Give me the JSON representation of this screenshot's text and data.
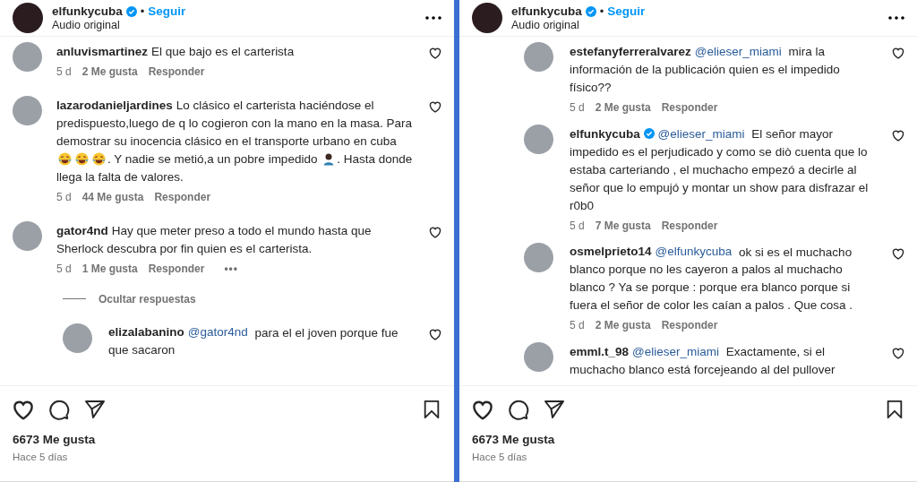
{
  "panels": [
    {
      "header": {
        "username": "elfunkycuba",
        "verified": true,
        "separator": "•",
        "follow": "Seguir",
        "subtitle": "Audio original"
      },
      "comments": [
        {
          "kind": "comment",
          "username": "anluvismartinez",
          "verified": false,
          "body": [
            {
              "kind": "text",
              "text": "El que bajo es el carterista"
            }
          ],
          "age": "5 d",
          "likes": "2 Me gusta",
          "reply": "Responder"
        },
        {
          "kind": "comment",
          "username": "lazarodanieljardines",
          "verified": false,
          "body": [
            {
              "kind": "text",
              "text": "Lo clásico el carterista haciéndose el predispuesto,luego de q lo cogieron con la mano en la masa. Para demostrar su inocencia clásico en el transporte urbano en cuba"
            },
            {
              "kind": "laugh-emoji"
            },
            {
              "kind": "laugh-emoji"
            },
            {
              "kind": "laugh-emoji"
            },
            {
              "kind": "text",
              "text": ". Y nadie se metió,a un pobre impedido"
            },
            {
              "kind": "person-emoji"
            },
            {
              "kind": "text",
              "text": ". Hasta donde llega la falta de valores."
            }
          ],
          "age": "5 d",
          "likes": "44 Me gusta",
          "reply": "Responder"
        },
        {
          "kind": "comment",
          "username": "gator4nd",
          "verified": false,
          "body": [
            {
              "kind": "text",
              "text": "Hay que meter preso a todo el mundo hasta que Sherlock descubra por fin quien es el carterista."
            }
          ],
          "age": "5 d",
          "likes": "1 Me gusta",
          "reply": "Responder",
          "more": "•••"
        },
        {
          "kind": "toggle",
          "text": "Ocultar respuestas"
        },
        {
          "kind": "reply",
          "username": "elizalabanino",
          "verified": false,
          "body": [
            {
              "kind": "mention",
              "text": "@gator4nd"
            },
            {
              "kind": "text",
              "text": "para el el joven porque fue que sacaron"
            }
          ]
        }
      ],
      "likes": "6673 Me gusta",
      "date": "Hace 5 días"
    },
    {
      "header": {
        "username": "elfunkycuba",
        "verified": true,
        "separator": "•",
        "follow": "Seguir",
        "subtitle": "Audio original"
      },
      "comments": [
        {
          "kind": "reply",
          "username": "estefanyferreralvarez",
          "verified": false,
          "body": [
            {
              "kind": "mention",
              "text": "@elieser_miami"
            },
            {
              "kind": "text",
              "text": "mira la información de la publicación quien es el impedido físico??"
            }
          ],
          "age": "5 d",
          "likes": "2 Me gusta",
          "reply": "Responder"
        },
        {
          "kind": "reply",
          "username": "elfunkycuba",
          "verified": true,
          "body": [
            {
              "kind": "mention",
              "text": "@elieser_miami"
            },
            {
              "kind": "text",
              "text": "El señor mayor impedido es el perjudicado y como se diò cuenta que lo estaba carteriando , el muchacho empezó a decirle al señor que lo empujó y montar un show para disfrazar el r0b0"
            }
          ],
          "age": "5 d",
          "likes": "7 Me gusta",
          "reply": "Responder"
        },
        {
          "kind": "reply",
          "username": "osmelprieto14",
          "verified": false,
          "body": [
            {
              "kind": "mention",
              "text": "@elfunkycuba"
            },
            {
              "kind": "text",
              "text": "ok si es el muchacho blanco porque no les cayeron a palos al muchacho blanco ? Ya se porque : porque era blanco porque si fuera el señor de color les caían a palos . Que cosa ."
            }
          ],
          "age": "5 d",
          "likes": "2 Me gusta",
          "reply": "Responder"
        },
        {
          "kind": "reply",
          "username": "emml.t_98",
          "verified": false,
          "body": [
            {
              "kind": "mention",
              "text": "@elieser_miami"
            },
            {
              "kind": "text",
              "text": "Exactamente, si el muchacho blanco está forcejeando al del pullover"
            }
          ]
        }
      ],
      "likes": "6673 Me gusta",
      "date": "Hace 5 días"
    }
  ]
}
